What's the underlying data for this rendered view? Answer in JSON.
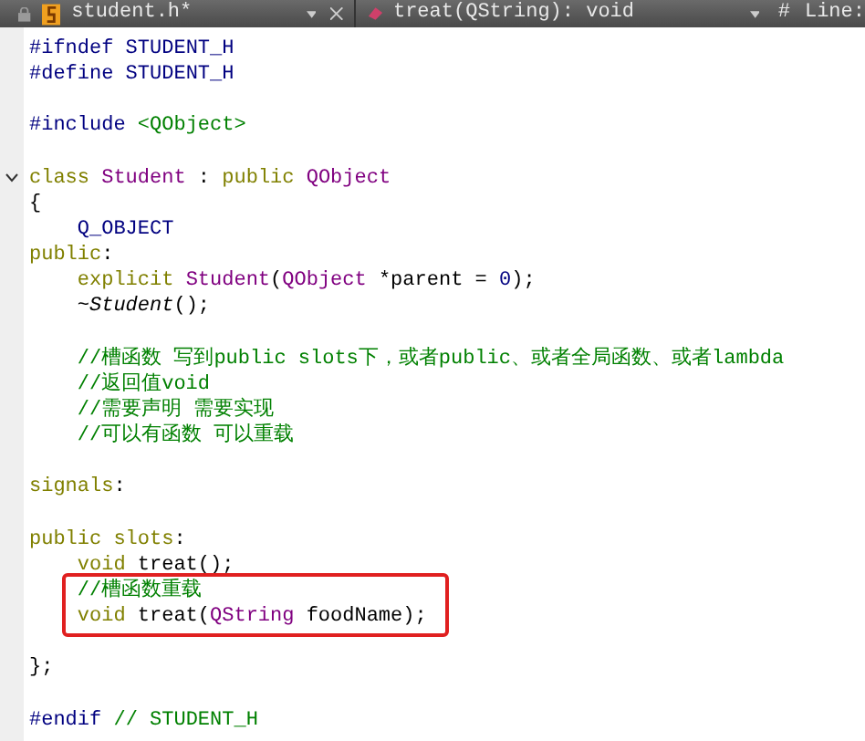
{
  "toolbar": {
    "file": "student.h*",
    "symbol": "treat(QString): void",
    "hash": "#",
    "line_label": "Line:"
  },
  "blocks": [
    {
      "lines": [
        {
          "fold": false,
          "highlighted": false,
          "indented": false,
          "tokens": [
            {
              "kind": "pre",
              "t": "#ifndef STUDENT_H"
            }
          ]
        },
        {
          "fold": false,
          "highlighted": false,
          "indented": false,
          "tokens": [
            {
              "kind": "pre",
              "t": "#define STUDENT_H"
            }
          ]
        }
      ]
    },
    {
      "lines": [
        {
          "fold": false,
          "highlighted": false,
          "indented": false,
          "tokens": [
            {
              "kind": "pre",
              "t": "#include "
            },
            {
              "kind": "string",
              "t": "<QObject>"
            }
          ]
        }
      ]
    },
    {
      "lines": [
        {
          "fold": true,
          "highlighted": false,
          "indented": false,
          "tokens": [
            {
              "kind": "kw",
              "t": "class "
            },
            {
              "kind": "type",
              "t": "Student"
            },
            {
              "kind": "text",
              "t": " : "
            },
            {
              "kind": "kw",
              "t": "public "
            },
            {
              "kind": "type",
              "t": "QObject"
            }
          ]
        },
        {
          "fold": false,
          "highlighted": false,
          "indented": false,
          "tokens": [
            {
              "kind": "text",
              "t": "{"
            }
          ]
        },
        {
          "fold": false,
          "highlighted": false,
          "indented": true,
          "tokens": [
            {
              "kind": "pre",
              "t": "Q_OBJECT"
            }
          ]
        },
        {
          "fold": false,
          "highlighted": false,
          "indented": false,
          "tokens": [
            {
              "kind": "kw",
              "t": "public"
            },
            {
              "kind": "text",
              "t": ":"
            }
          ]
        },
        {
          "fold": false,
          "highlighted": false,
          "indented": true,
          "tokens": [
            {
              "kind": "kw",
              "t": "explicit "
            },
            {
              "kind": "type",
              "t": "Student"
            },
            {
              "kind": "text",
              "t": "("
            },
            {
              "kind": "type",
              "t": "QObject"
            },
            {
              "kind": "text",
              "t": " *parent = "
            },
            {
              "kind": "pre",
              "t": "0"
            },
            {
              "kind": "text",
              "t": ");"
            }
          ]
        },
        {
          "fold": false,
          "highlighted": false,
          "indented": true,
          "tokens": [
            {
              "kind": "text",
              "t": "~"
            },
            {
              "kind": "italic",
              "t": "Student"
            },
            {
              "kind": "text",
              "t": "();"
            }
          ]
        }
      ]
    },
    {
      "lines": [
        {
          "fold": false,
          "highlighted": false,
          "indented": true,
          "tokens": [
            {
              "kind": "comment",
              "t": "//槽函数 写到public slots下，或者public、或者全局函数、或者lambda"
            }
          ]
        },
        {
          "fold": false,
          "highlighted": false,
          "indented": true,
          "tokens": [
            {
              "kind": "comment",
              "t": "//返回值void"
            }
          ]
        },
        {
          "fold": false,
          "highlighted": false,
          "indented": true,
          "tokens": [
            {
              "kind": "comment",
              "t": "//需要声明 需要实现"
            }
          ]
        },
        {
          "fold": false,
          "highlighted": false,
          "indented": true,
          "tokens": [
            {
              "kind": "comment",
              "t": "//可以有函数 可以重载"
            }
          ]
        }
      ]
    },
    {
      "lines": [
        {
          "fold": false,
          "highlighted": false,
          "indented": false,
          "tokens": [
            {
              "kind": "kw",
              "t": "signals"
            },
            {
              "kind": "text",
              "t": ":"
            }
          ]
        }
      ]
    },
    {
      "lines": [
        {
          "fold": false,
          "highlighted": false,
          "indented": false,
          "tokens": [
            {
              "kind": "kw",
              "t": "public slots"
            },
            {
              "kind": "text",
              "t": ":"
            }
          ]
        },
        {
          "fold": false,
          "highlighted": false,
          "indented": true,
          "tokens": [
            {
              "kind": "kw",
              "t": "void "
            },
            {
              "kind": "text",
              "t": "treat();"
            }
          ]
        },
        {
          "fold": false,
          "highlighted": true,
          "indented": true,
          "tokens": [
            {
              "kind": "comment",
              "t": "//槽函数重载"
            }
          ]
        },
        {
          "fold": false,
          "highlighted": true,
          "indented": true,
          "tokens": [
            {
              "kind": "kw",
              "t": "void "
            },
            {
              "kind": "text",
              "t": "treat("
            },
            {
              "kind": "type",
              "t": "QString "
            },
            {
              "kind": "text",
              "t": "foodName);"
            }
          ]
        }
      ]
    },
    {
      "lines": [
        {
          "fold": false,
          "highlighted": false,
          "indented": false,
          "tokens": [
            {
              "kind": "text",
              "t": "};"
            }
          ]
        }
      ]
    },
    {
      "lines": [
        {
          "fold": false,
          "highlighted": false,
          "indented": false,
          "tokens": [
            {
              "kind": "pre",
              "t": "#endif "
            },
            {
              "kind": "comment",
              "t": "// STUDENT_H"
            }
          ]
        }
      ]
    }
  ]
}
